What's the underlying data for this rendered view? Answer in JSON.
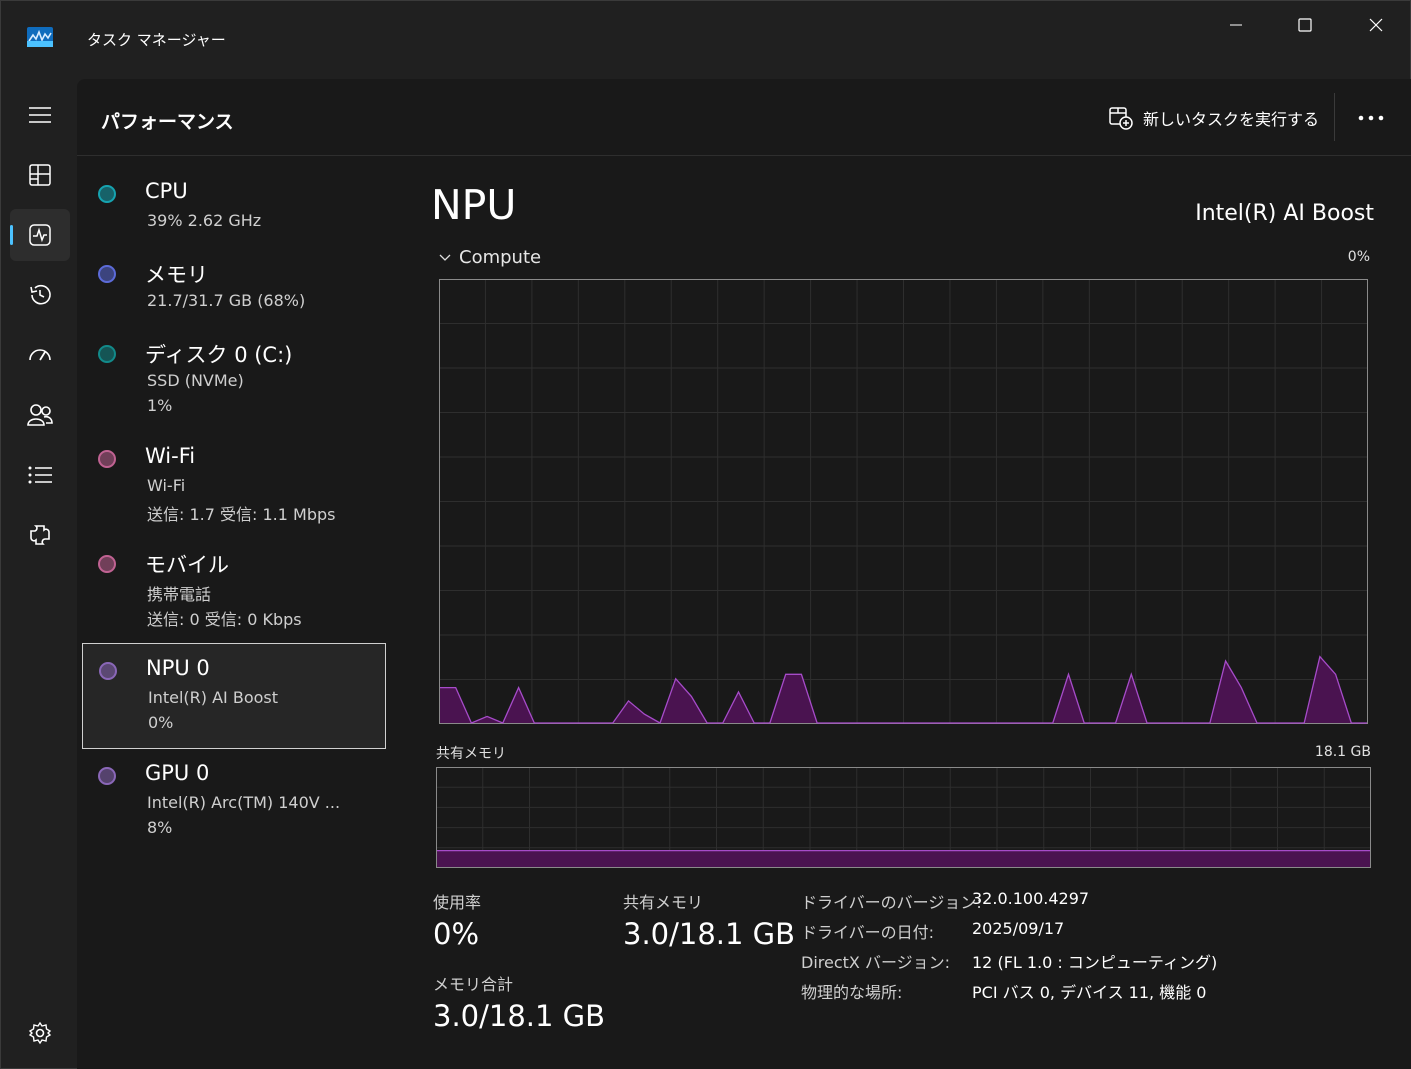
{
  "window": {
    "title": "タスク マネージャー"
  },
  "header": {
    "page_title": "パフォーマンス",
    "run_task_label": "新しいタスクを実行する"
  },
  "nav": [
    {
      "icon": "hamburger-menu-icon"
    },
    {
      "icon": "processes-icon"
    },
    {
      "icon": "performance-icon",
      "active": true
    },
    {
      "icon": "app-history-icon"
    },
    {
      "icon": "startup-apps-icon"
    },
    {
      "icon": "users-icon"
    },
    {
      "icon": "details-icon"
    },
    {
      "icon": "services-icon"
    },
    {
      "icon": "settings-icon"
    }
  ],
  "devices": [
    {
      "name": "CPU",
      "lines": [
        "39%  2.62 GHz"
      ],
      "color": "#16a3b0"
    },
    {
      "name": "メモリ",
      "lines": [
        "21.7/31.7 GB (68%)"
      ],
      "color": "#5c6bd8"
    },
    {
      "name": "ディスク 0 (C:)",
      "lines": [
        "SSD (NVMe)",
        "1%"
      ],
      "color": "#128a8a"
    },
    {
      "name": "Wi-Fi",
      "lines": [
        "Wi-Fi",
        "送信: 1.7  受信: 1.1 Mbps"
      ],
      "color": "#c06292"
    },
    {
      "name": "モバイル",
      "lines": [
        "携帯電話",
        "送信: 0  受信: 0 Kbps"
      ],
      "color": "#c06292"
    },
    {
      "name": "NPU 0",
      "lines": [
        "Intel(R) AI Boost",
        "0%"
      ],
      "color": "#8a67b8",
      "selected": true
    },
    {
      "name": "GPU 0",
      "lines": [
        "Intel(R) Arc(TM) 140V ...",
        "8%"
      ],
      "color": "#8a67b8"
    }
  ],
  "detail": {
    "title": "NPU",
    "model": "Intel(R) AI Boost",
    "compute_label": "Compute",
    "compute_pct": "0%",
    "shared_label": "共有メモリ",
    "shared_max": "18.1 GB",
    "stats": {
      "usage_label": "使用率",
      "usage_value": "0%",
      "shared_label": "共有メモリ",
      "shared_value": "3.0/18.1 GB",
      "total_label": "メモリ合計",
      "total_value": "3.0/18.1 GB"
    },
    "info": [
      {
        "key": "ドライバーのバージョン:",
        "value": "32.0.100.4297"
      },
      {
        "key": "ドライバーの日付:",
        "value": "2025/09/17"
      },
      {
        "key": "DirectX バージョン:",
        "value": "12 (FL 1.0 : コンピューティング)"
      },
      {
        "key": "物理的な場所:",
        "value": "PCI バス 0, デバイス 11, 機能 0"
      }
    ]
  },
  "chart_data": [
    {
      "type": "area",
      "title": "Compute",
      "ylim": [
        0,
        100
      ],
      "x_samples": 60,
      "values": [
        8,
        8,
        0,
        1.5,
        0,
        8,
        0,
        0,
        0,
        0,
        0,
        0,
        5,
        2,
        0,
        10,
        6,
        0,
        0,
        7,
        0,
        0,
        11,
        11,
        0,
        0,
        0,
        0,
        0,
        0,
        0,
        0,
        0,
        0,
        0,
        0,
        0,
        0,
        0,
        0,
        11,
        0,
        0,
        0,
        11,
        0,
        0,
        0,
        0,
        0,
        14,
        8,
        0,
        0,
        0,
        0,
        15,
        11,
        0,
        0
      ],
      "color": "#a64cc9"
    },
    {
      "type": "area",
      "title": "共有メモリ",
      "ylim": [
        0,
        18.1
      ],
      "unit": "GB",
      "values_constant": 3.0,
      "color": "#a64cc9"
    }
  ]
}
